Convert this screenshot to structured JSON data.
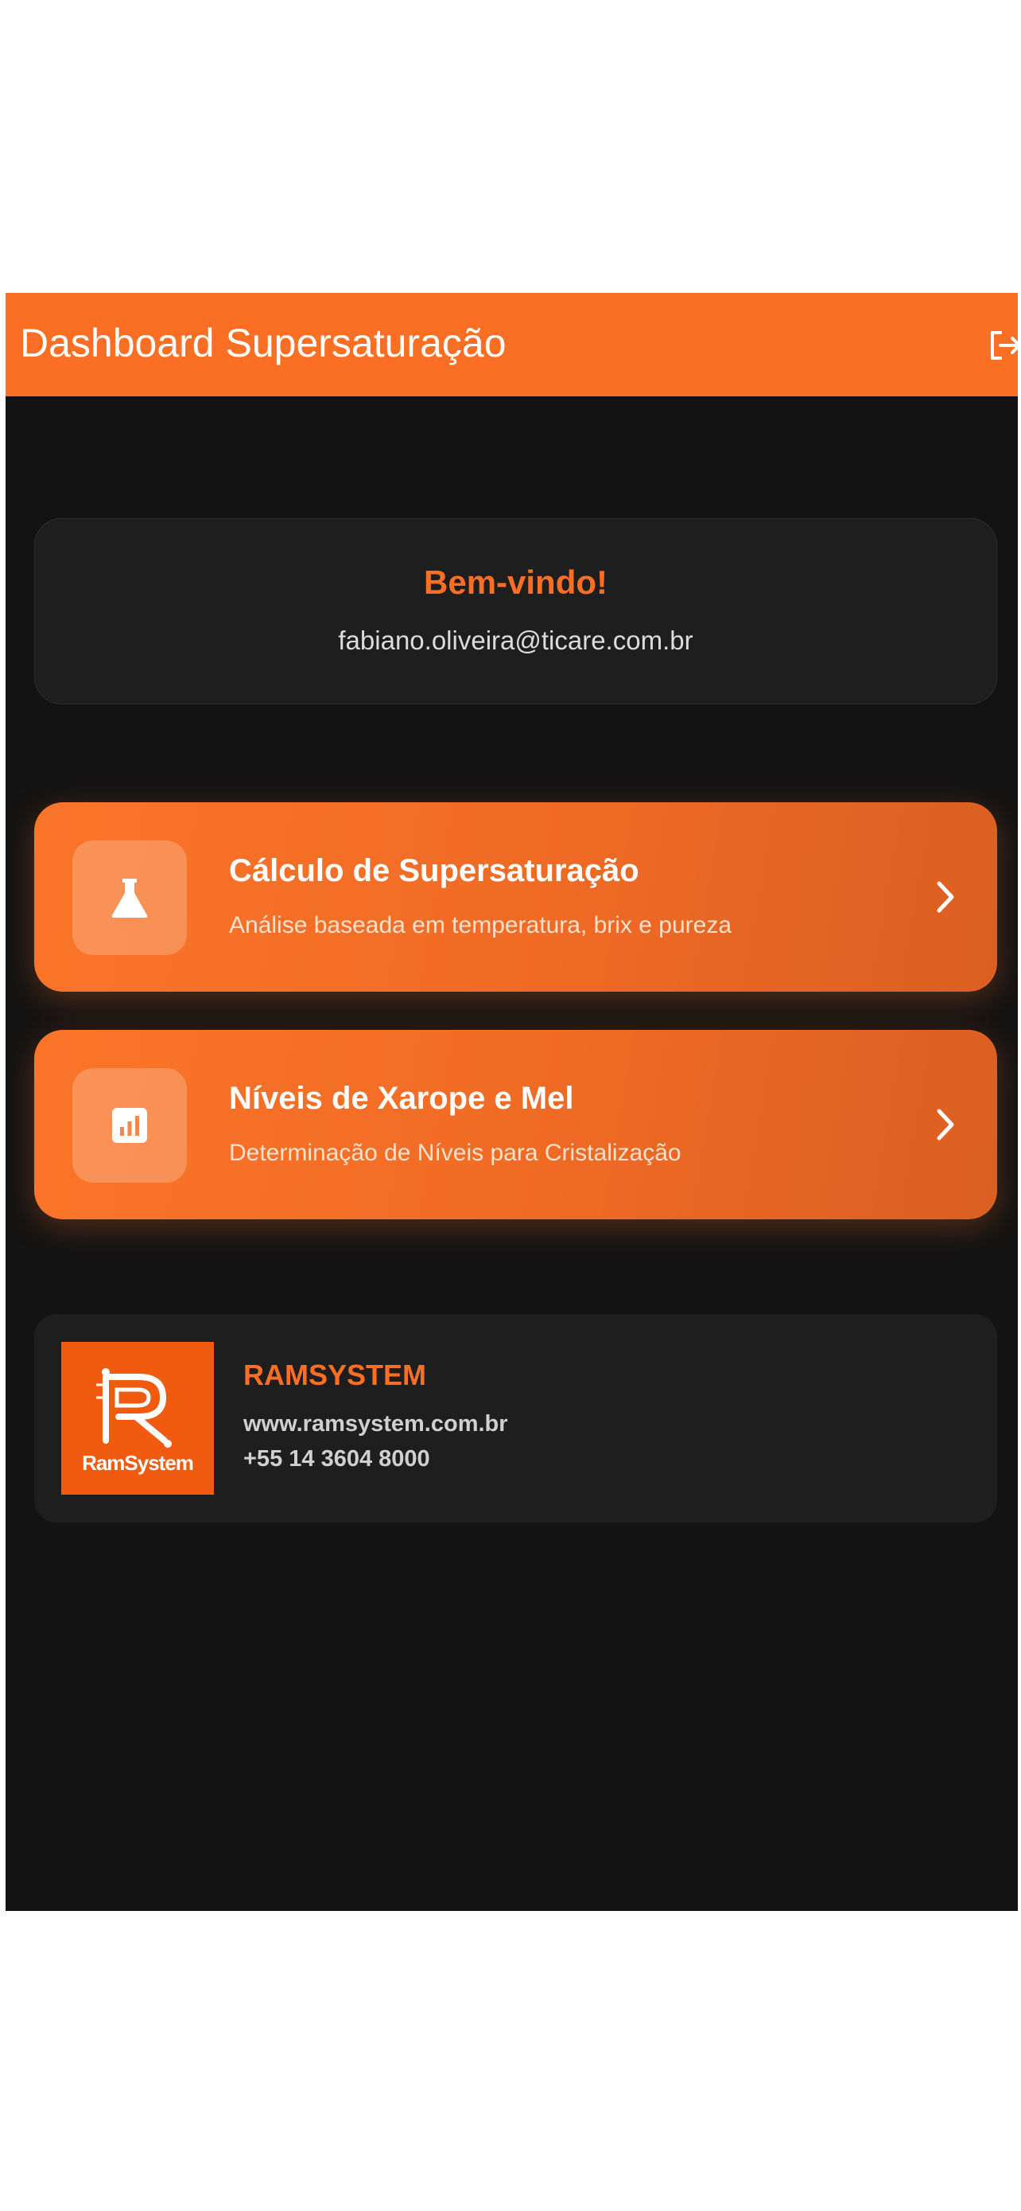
{
  "appbar": {
    "title": "Dashboard Supersaturação",
    "background": "#fb6f24",
    "logout_icon": "logout-icon"
  },
  "welcome": {
    "title": "Bem-vindo!",
    "email": "fabiano.oliveira@ticare.com.br"
  },
  "menu": [
    {
      "icon": "flask-icon",
      "title": "Cálculo de Supersaturação",
      "subtitle": "Análise baseada em temperatura, brix e pureza"
    },
    {
      "icon": "bar-chart-icon",
      "title": "Níveis de Xarope e Mel",
      "subtitle": "Determinação de Níveis para Cristalização"
    }
  ],
  "company": {
    "logo_text": "RamSystem",
    "name": "RAMSYSTEM",
    "website": "www.ramsystem.com.br",
    "phone": "+55 14 3604 8000"
  },
  "colors": {
    "accent": "#fb6f24",
    "background": "#131313",
    "card": "#1e1e1e"
  }
}
